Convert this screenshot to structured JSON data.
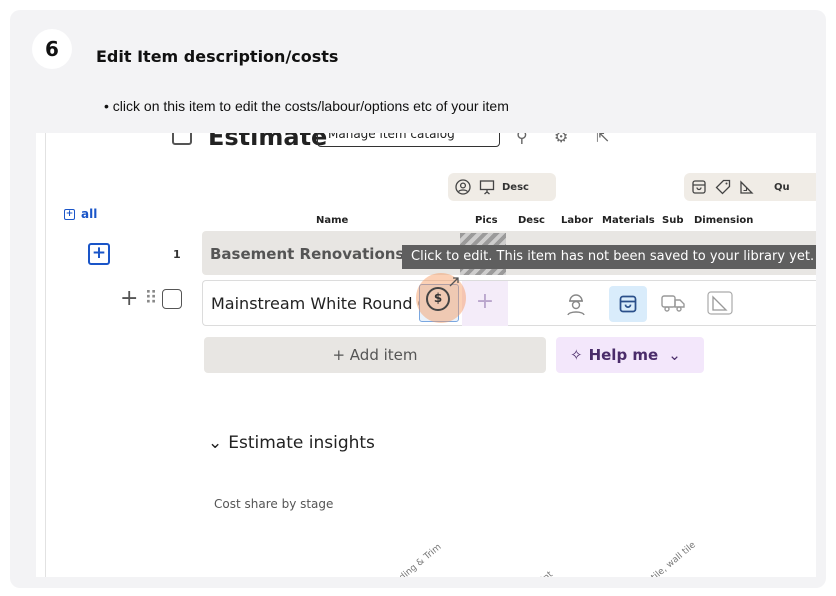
{
  "guide": {
    "step_number": "6",
    "title": "Edit Item description/costs",
    "description": "• click on this item to edit the costs/labour/options etc of your item"
  },
  "estimate_header": {
    "title": "Estimate",
    "manage_button": "Manage item catalog"
  },
  "column_groups": {
    "desc_chip": "Desc",
    "quantity_chip": "Qu"
  },
  "toggle_all_label": "all",
  "columns": [
    "Name",
    "Pics",
    "Desc",
    "Labor",
    "Materials",
    "Sub",
    "Dimension"
  ],
  "rows": [
    {
      "number": "1",
      "name": "Basement Renovations"
    },
    {
      "name": "Mainstream White Round C"
    }
  ],
  "tooltip": "Click to edit. This item has not been saved to your library yet.",
  "add_item_label": "+ Add item",
  "help_label": "Help me",
  "insights": {
    "title": "Estimate insights",
    "subtitle": "Cost share by stage",
    "stage_labels": [
      "ding & Trim",
      "int",
      "tile, wall tile"
    ]
  }
}
